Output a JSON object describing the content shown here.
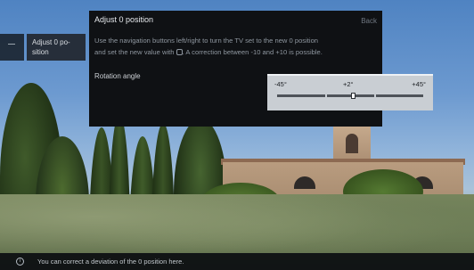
{
  "side_menu": {
    "item_label": "Adjust 0 po-sition"
  },
  "panel": {
    "title": "Adjust 0 position",
    "back_label": "Back",
    "description_line1": "Use the navigation buttons left/right to turn the TV set to the new 0 position",
    "description_line2a": "and set the new value with",
    "description_line2b": ". A correction between -10 and +10 is possible.",
    "ok_icon": "ok-button-icon",
    "rotation": {
      "label": "Rotation angle",
      "min_label": "-45°",
      "current_label": "+2°",
      "max_label": "+45°",
      "min": -45,
      "max": 45,
      "value": 2
    }
  },
  "info_bar": {
    "icon": "info-icon",
    "text": "You can correct a deviation of the 0 position here."
  }
}
